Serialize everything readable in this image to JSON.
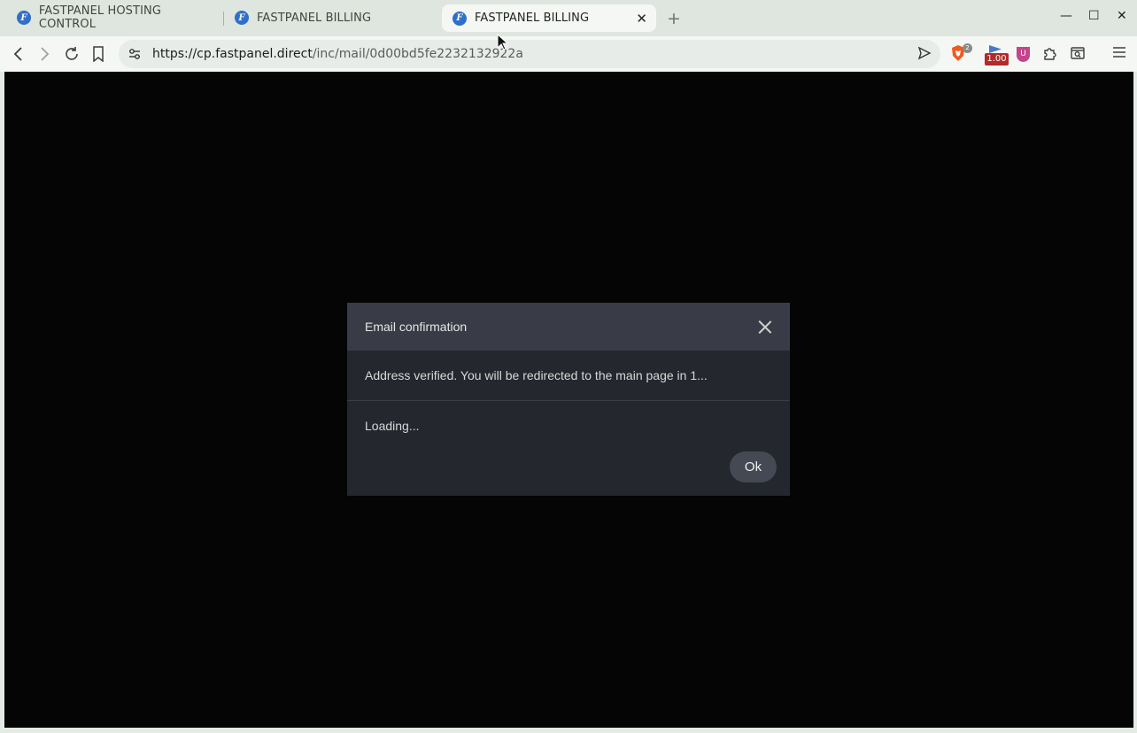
{
  "browser": {
    "tabs": [
      {
        "title": "FASTPANEL HOSTING CONTROL"
      },
      {
        "title": "FASTPANEL BILLING"
      },
      {
        "title": "FASTPANEL BILLING",
        "active": true
      }
    ],
    "favicon_letter": "F",
    "close_tab": "✕",
    "new_tab": "+",
    "url_host": "https://cp.fastpanel.direct",
    "url_path": "/inc/mail/0d00bd5fe2232132922a",
    "extension_badge_count": "2",
    "extension_price": "1.00",
    "shield_letter": "U",
    "win_minimize": "—",
    "win_maximize": "☐",
    "win_close": "✕",
    "icons": [
      "back-icon",
      "forward-icon",
      "reload-icon",
      "bookmark-icon",
      "site-settings-icon",
      "send-icon",
      "brave-shields-icon",
      "extensions-icon",
      "search-tabs-icon",
      "menu-icon"
    ]
  },
  "modal": {
    "title": "Email confirmation",
    "message": "Address verified. You will be redirected to the main page in 1...",
    "loading": "Loading...",
    "ok_label": "Ok"
  },
  "colors": {
    "page_background": "#050505",
    "modal_background": "#24272d",
    "modal_header": "#393c46",
    "ok_button": "#454953"
  }
}
